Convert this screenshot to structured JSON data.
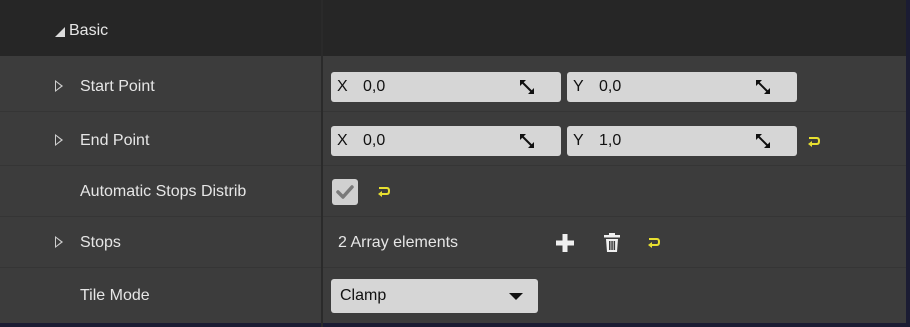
{
  "category": {
    "label": "Basic"
  },
  "rows": {
    "start_point": {
      "label": "Start Point",
      "x": {
        "axis": "X",
        "value": "0,0"
      },
      "y": {
        "axis": "Y",
        "value": "0,0"
      }
    },
    "end_point": {
      "label": "End Point",
      "x": {
        "axis": "X",
        "value": "0,0"
      },
      "y": {
        "axis": "Y",
        "value": "1,0"
      }
    },
    "automatic_stops": {
      "label": "Automatic Stops Distrib",
      "checked": true
    },
    "stops": {
      "label": "Stops",
      "summary": "2 Array elements"
    },
    "tile_mode": {
      "label": "Tile Mode",
      "selected": "Clamp"
    }
  },
  "colors": {
    "panel_bg": "#3c3c3c",
    "header_bg": "#262626",
    "field_bg": "#d6d6d6",
    "reset_arrow": "#e8e030",
    "outer_bg": "#1b1c33"
  },
  "icons": [
    "expander-triangle-icon",
    "drag-arrows-icon",
    "reset-to-default-icon",
    "checkmark-icon",
    "add-plus-icon",
    "trash-icon",
    "chevron-down-icon"
  ]
}
